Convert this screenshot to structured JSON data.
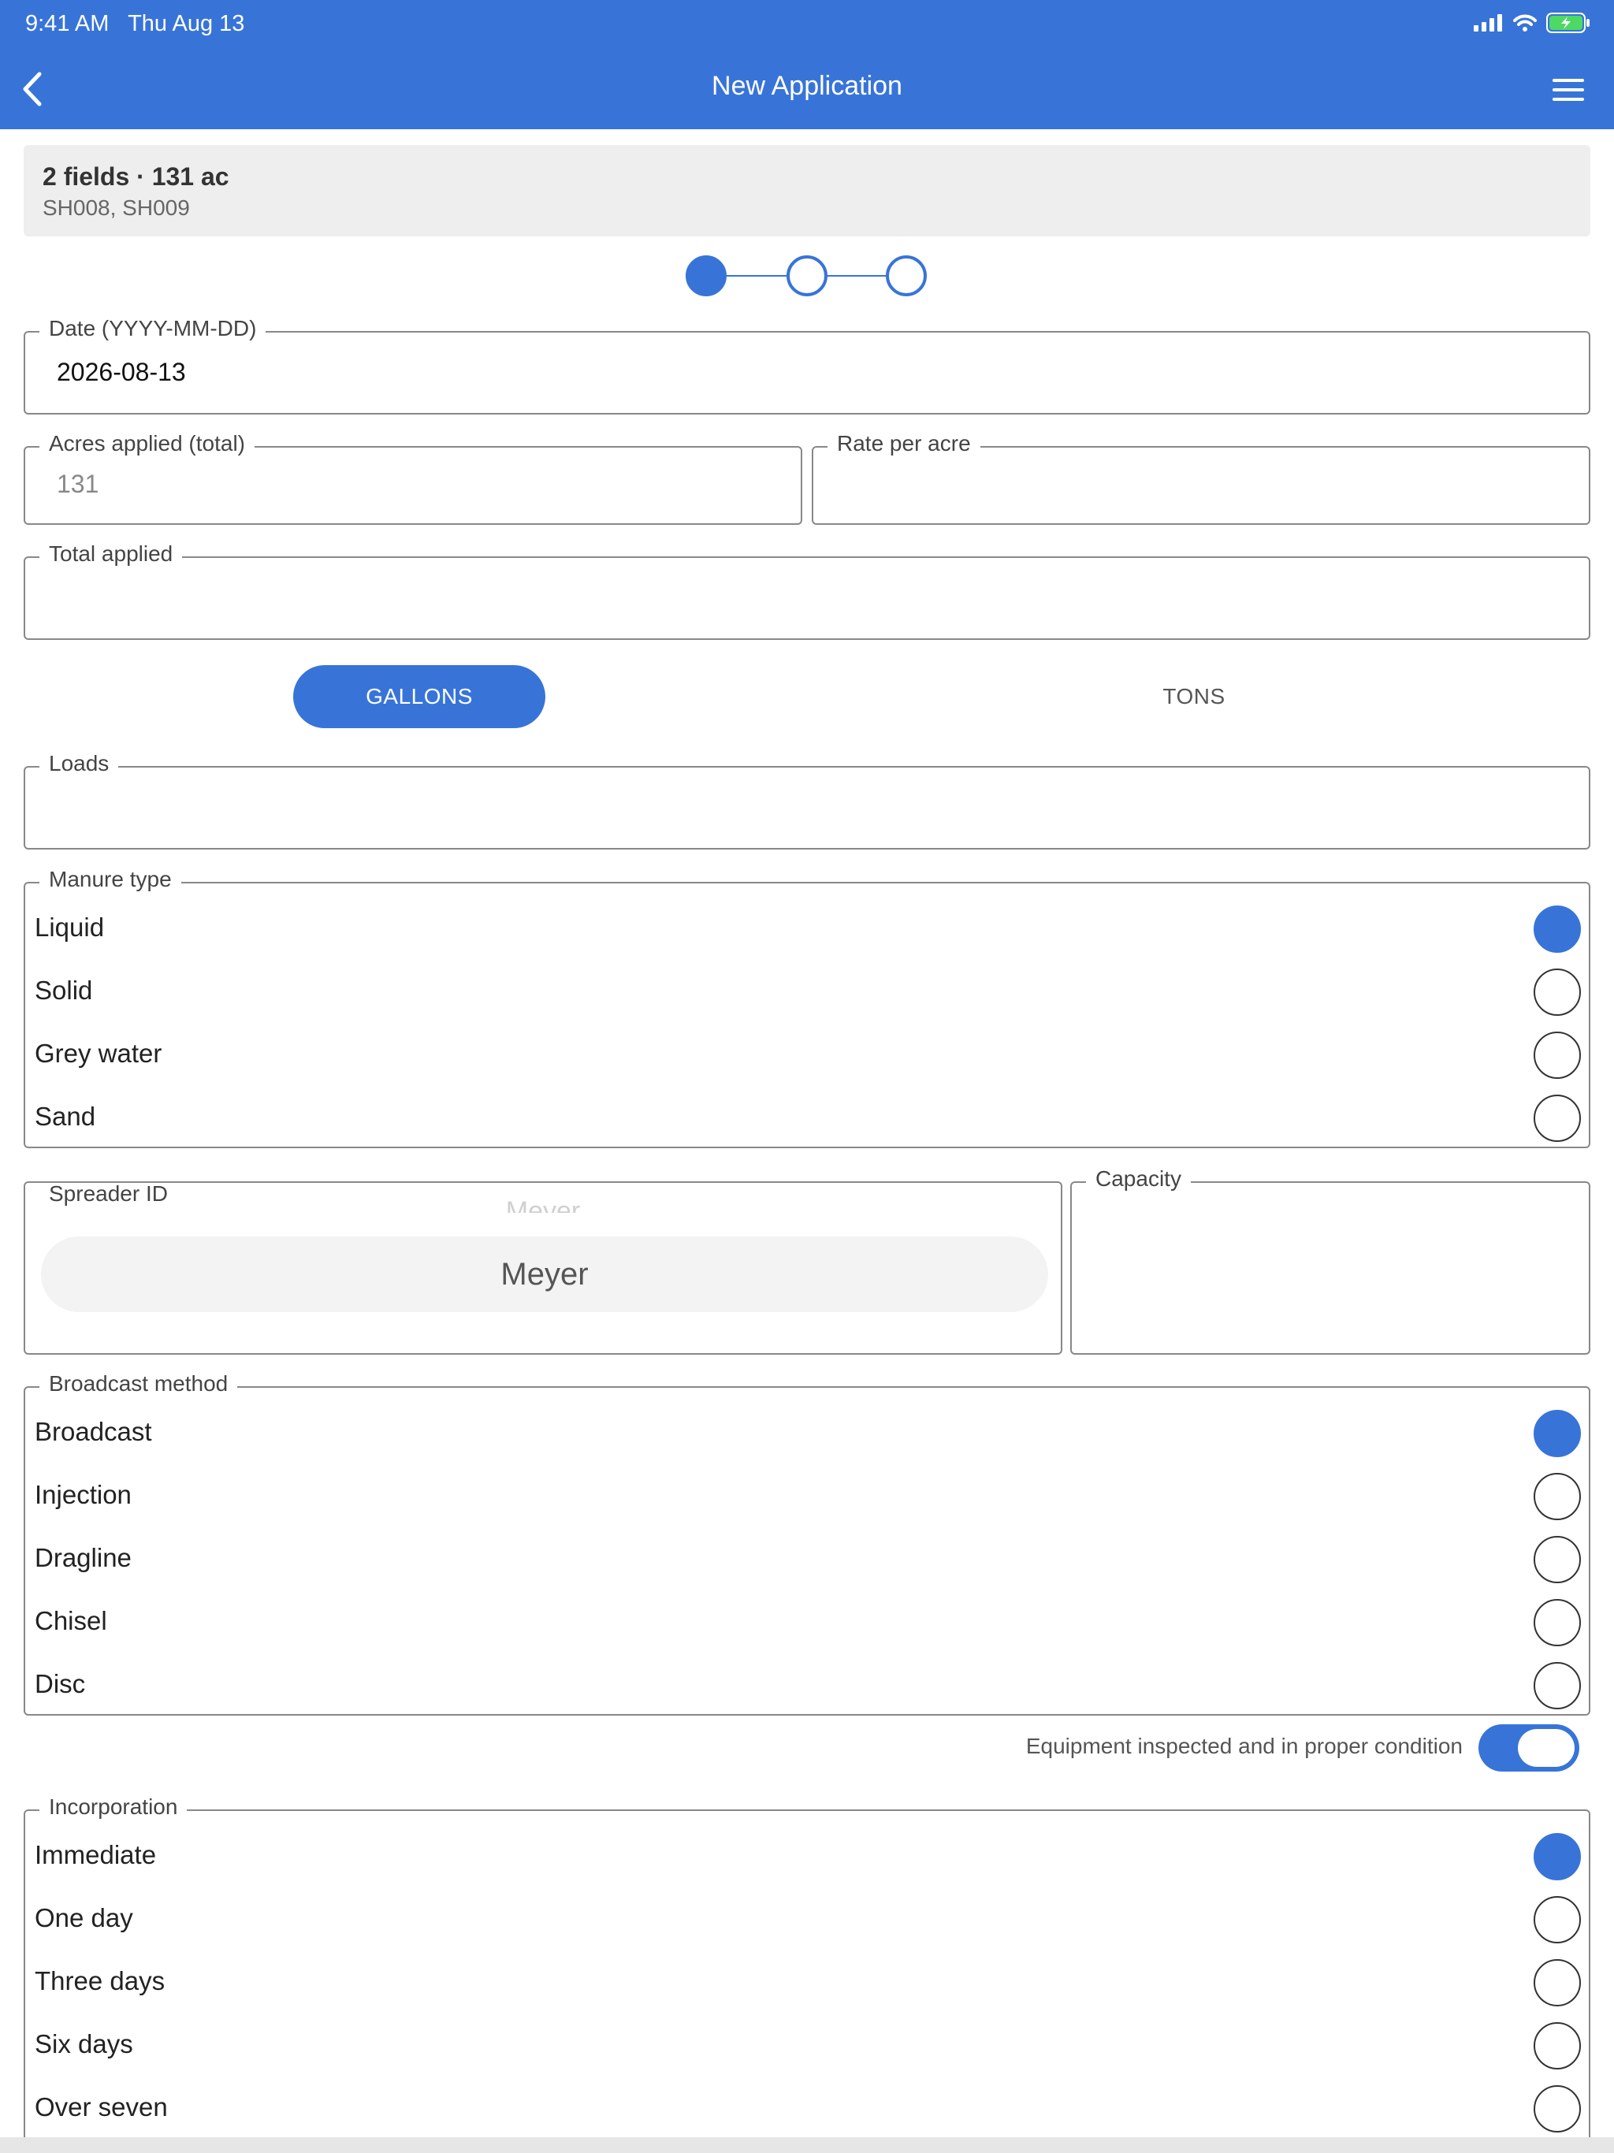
{
  "status_bar": {
    "time": "9:41 AM",
    "date": "Thu Aug 13"
  },
  "header": {
    "title": "New Application"
  },
  "summary": {
    "title": "2 fields · 131 ac",
    "fields": "SH008, SH009"
  },
  "stepper": {
    "current_step": 1,
    "total_steps": 3
  },
  "form": {
    "date": {
      "label": "Date (YYYY-MM-DD)",
      "value": "2026-08-13"
    },
    "acres": {
      "label": "Acres applied (total)",
      "placeholder": "131"
    },
    "rate": {
      "label": "Rate per acre",
      "value": ""
    },
    "total": {
      "label": "Total applied",
      "value": ""
    },
    "units": {
      "gallons": "GALLONS",
      "tons": "TONS",
      "selected": "GALLONS"
    },
    "loads": {
      "label": "Loads",
      "value": ""
    },
    "manure_type": {
      "label": "Manure type",
      "options": [
        "Liquid",
        "Solid",
        "Grey water",
        "Sand"
      ],
      "selected": "Liquid"
    },
    "spreader": {
      "label": "Spreader ID",
      "value": "Meyer",
      "ghost": "Meyer"
    },
    "capacity": {
      "label": "Capacity",
      "value": ""
    },
    "broadcast_method": {
      "label": "Broadcast method",
      "options": [
        "Broadcast",
        "Injection",
        "Dragline",
        "Chisel",
        "Disc"
      ],
      "selected": "Broadcast"
    },
    "equipment": {
      "label": "Equipment inspected and in proper condition",
      "checked": true
    },
    "incorporation": {
      "label": "Incorporation",
      "options": [
        "Immediate",
        "One day",
        "Three days",
        "Six days",
        "Over seven"
      ],
      "selected": "Immediate"
    }
  },
  "colors": {
    "accent": "#3874d8",
    "battery": "#4cd964"
  }
}
